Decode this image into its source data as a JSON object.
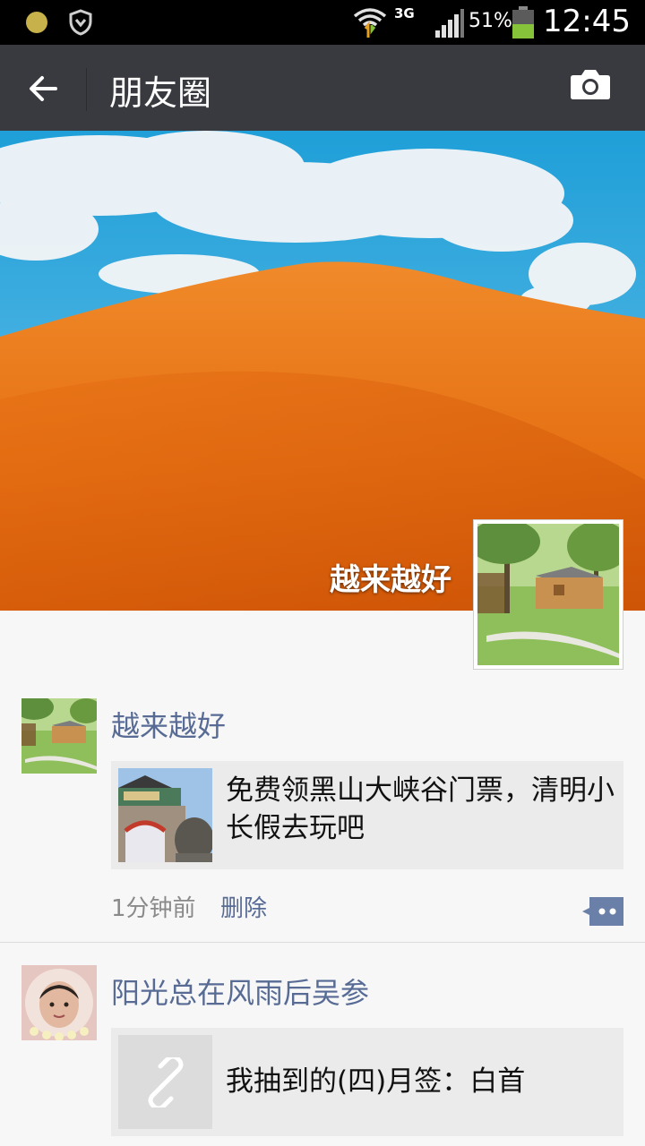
{
  "status_bar": {
    "network": "3G",
    "battery_percent": "51%",
    "battery_level": 0.51,
    "time": "12:45",
    "icons": [
      "notification-dot-icon",
      "shield-icon",
      "wifi-icon",
      "signal-icon",
      "battery-icon"
    ]
  },
  "header": {
    "title": "朋友圈",
    "back_icon": "arrow-left-icon",
    "camera_icon": "camera-icon"
  },
  "cover": {
    "user_name": "越来越好"
  },
  "posts": [
    {
      "user_name": "越来越好",
      "link_text": "免费领黑山大峡谷门票，清明小长假去玩吧",
      "time": "1分钟前",
      "delete_label": "删除"
    },
    {
      "user_name": "阳光总在风雨后吴参",
      "link_text": "我抽到的(四)月签：白首",
      "link_icon": "link-icon"
    }
  ],
  "colors": {
    "header_bg": "#393a3f",
    "name_link": "#576b95",
    "card_bg": "#ebebeb",
    "page_bg": "#f7f7f7"
  }
}
